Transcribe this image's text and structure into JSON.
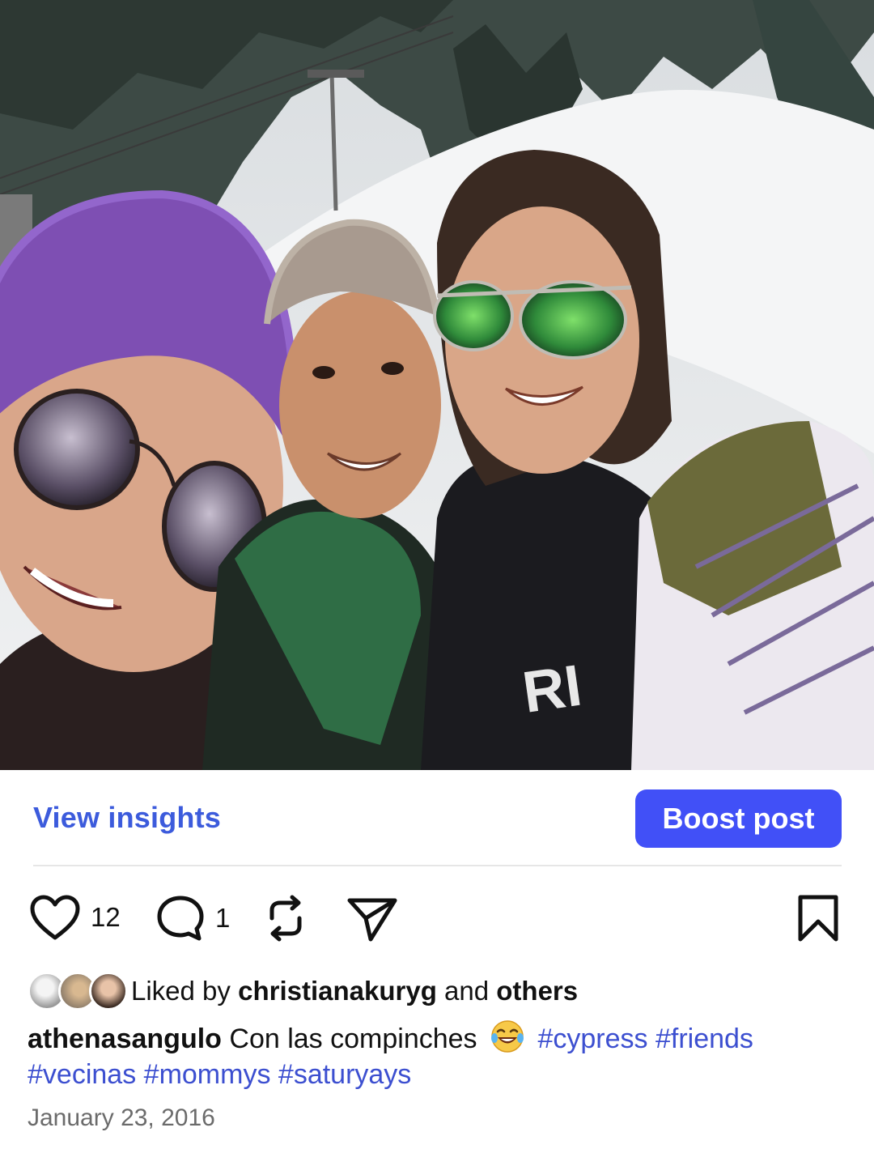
{
  "post": {
    "photo_description_icon": "photo"
  },
  "insights": {
    "view_label": "View insights",
    "boost_label": "Boost post"
  },
  "actions": {
    "like_count": "12",
    "comment_count": "1"
  },
  "liked_by": {
    "prefix": "Liked by",
    "user": "christianakuryg",
    "middle": "and",
    "suffix": "others"
  },
  "caption": {
    "username": "athenasangulo",
    "text": "Con las compinches",
    "emoji": "face-with-tears-of-joy",
    "hashtags_line1": [
      "#cypress",
      "#friends"
    ],
    "hashtags_line2": [
      "#vecinas",
      "#mommys",
      "#saturyays"
    ]
  },
  "date": "January 23, 2016",
  "colors": {
    "accent": "#3c5bdc",
    "boost_bg": "#4150f7",
    "hashtag": "#3c4fd0"
  }
}
